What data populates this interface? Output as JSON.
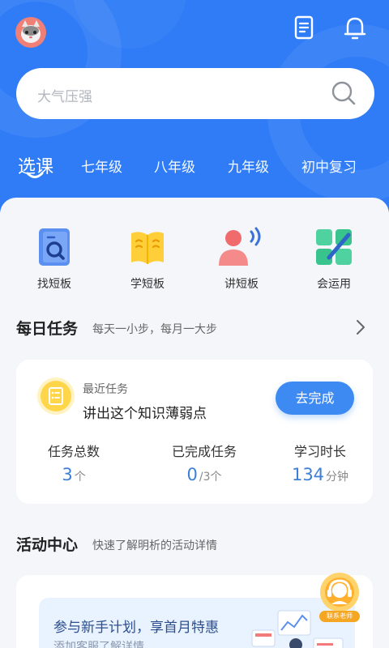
{
  "header": {
    "icons": [
      "avatar-cat",
      "document-icon",
      "bell-icon"
    ],
    "search_placeholder": "大气压强"
  },
  "tabs": [
    {
      "label": "选课",
      "active": true
    },
    {
      "label": "七年级",
      "active": false
    },
    {
      "label": "八年级",
      "active": false
    },
    {
      "label": "九年级",
      "active": false
    },
    {
      "label": "初中复习",
      "active": false
    }
  ],
  "quick_actions": [
    {
      "label": "找短板",
      "icon": "magnifier-book-icon"
    },
    {
      "label": "学短板",
      "icon": "open-book-icon"
    },
    {
      "label": "讲短板",
      "icon": "speaker-person-icon"
    },
    {
      "label": "会运用",
      "icon": "puzzle-pencil-icon"
    }
  ],
  "daily_tasks": {
    "title": "每日任务",
    "subtitle": "每天一小步，每月一大步",
    "recent_label": "最近任务",
    "recent_title": "讲出这个知识薄弱点",
    "button_label": "去完成",
    "stats": {
      "total": {
        "label": "任务总数",
        "value": "3",
        "unit": "个"
      },
      "done": {
        "label": "已完成任务",
        "value": "0",
        "unit": "/3个"
      },
      "time": {
        "label": "学习时长",
        "value": "134",
        "unit": "分钟"
      }
    }
  },
  "activity": {
    "title": "活动中心",
    "subtitle": "快速了解明析的活动详情",
    "banner_title": "参与新手计划，享首月特惠",
    "banner_sub": "添加客服了解详情"
  },
  "fab": {
    "label": "联系老师"
  },
  "colors": {
    "primary": "#2f7cf6",
    "accent_button": "#3d8bf2",
    "stat_number": "#3d7fd6",
    "task_icon": "#ffd54a"
  }
}
